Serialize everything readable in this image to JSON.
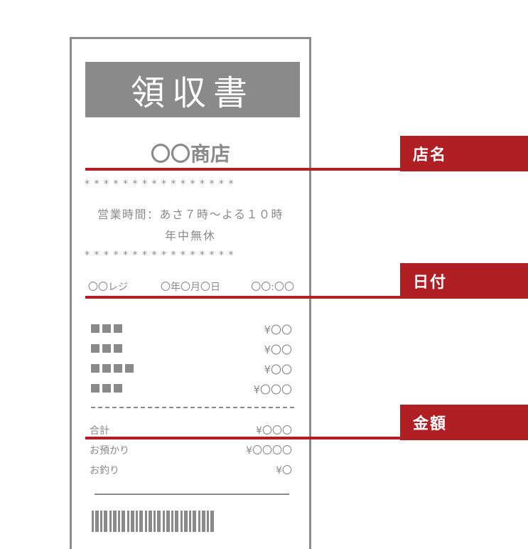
{
  "receipt": {
    "title": "領収書",
    "shop_name": "〇〇商店",
    "stars": "****************",
    "hours": "営業時間：あさ７時～よる１０時",
    "holiday": "年中無休",
    "register": "〇〇レジ",
    "date": "〇年〇月〇日",
    "time": "〇〇:〇〇",
    "items": [
      {
        "blocks": 3,
        "price": "¥〇〇"
      },
      {
        "blocks": 3,
        "price": "¥〇〇"
      },
      {
        "blocks": 4,
        "price": "¥〇〇"
      },
      {
        "blocks": 3,
        "price": "¥〇〇〇"
      }
    ],
    "total_label": "合計",
    "total_value": "¥〇〇〇",
    "received_label": "お預かり",
    "received_value": "¥〇〇〇〇",
    "change_label": "お釣り",
    "change_value": "¥〇"
  },
  "callouts": {
    "shop": "店名",
    "date": "日付",
    "amount": "金額"
  },
  "colors": {
    "accent": "#b01f24",
    "receipt_gray": "#8a8a8a"
  }
}
